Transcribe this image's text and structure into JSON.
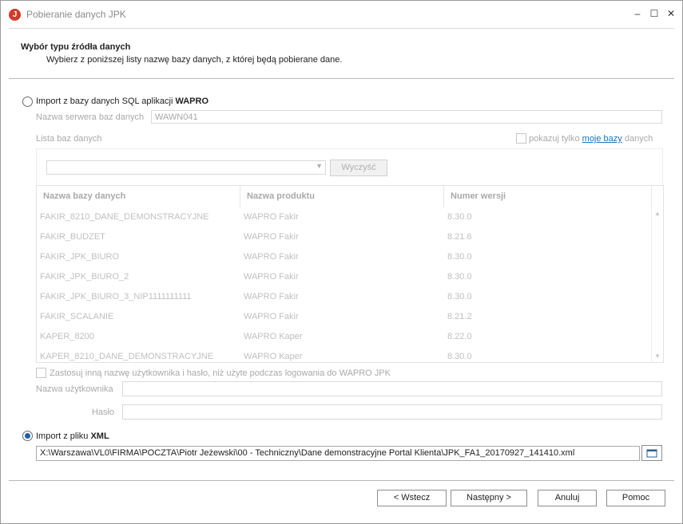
{
  "window": {
    "title": "Pobieranie danych JPK",
    "icon_letter": "J",
    "minimize": "–",
    "maximize": "☐",
    "close": "✕"
  },
  "header": {
    "title": "Wybór typu źródła danych",
    "subtitle": "Wybierz z poniższej listy nazwę bazy danych, z której będą pobierane dane."
  },
  "sql_import": {
    "label_prefix": "Import z bazy danych SQL aplikacji ",
    "label_bold": "WAPRO",
    "selected": false,
    "server_label": "Nazwa serwera baz danych",
    "server_value": "WAWN041",
    "db_list_label": "Lista baz danych",
    "show_only_prefix": "pokazuj tylko ",
    "show_only_link": "moje bazy",
    "show_only_suffix": " danych",
    "combo_value": "",
    "clear_button": "Wyczyść",
    "columns": [
      "Nazwa bazy danych",
      "Nazwa produktu",
      "Numer wersji"
    ],
    "rows": [
      [
        "FAKIR_8210_DANE_DEMONSTRACYJNE",
        "WAPRO Fakir",
        "8.30.0"
      ],
      [
        "FAKIR_BUDZET",
        "WAPRO Fakir",
        "8.21.6"
      ],
      [
        "FAKIR_JPK_BIURO",
        "WAPRO Fakir",
        "8.30.0"
      ],
      [
        "FAKIR_JPK_BIURO_2",
        "WAPRO Fakir",
        "8.30.0"
      ],
      [
        "FAKIR_JPK_BIURO_3_NIP1111111111",
        "WAPRO Fakir",
        "8.30.0"
      ],
      [
        "FAKIR_SCALANIE",
        "WAPRO Fakir",
        "8.21.2"
      ],
      [
        "KAPER_8200",
        "WAPRO Kaper",
        "8.22.0"
      ],
      [
        "KAPER_8210_DANE_DEMONSTRACYJNE",
        "WAPRO Kaper",
        "8.30.0"
      ]
    ],
    "other_user_label": "Zastosuj inną nazwę użytkownika i hasło, niż użyte podczas logowania do WAPRO JPK",
    "username_label": "Nazwa użytkownika",
    "username_value": "",
    "password_label": "Hasło",
    "password_value": ""
  },
  "xml_import": {
    "label_prefix": "Import z pliku ",
    "label_bold": "XML",
    "selected": true,
    "path": "X:\\Warszawa\\VL0\\FIRMA\\POCZTA\\Piotr Jeżewski\\00 - Techniczny\\Dane demonstracyjne Portal Klienta\\JPK_FA1_20170927_141410.xml"
  },
  "footer": {
    "back": "< Wstecz",
    "next": "Następny >",
    "cancel": "Anuluj",
    "help": "Pomoc"
  },
  "colors": {
    "accent": "#1e5fa6",
    "app_icon": "#d23a2a",
    "link": "#1e74b8"
  }
}
